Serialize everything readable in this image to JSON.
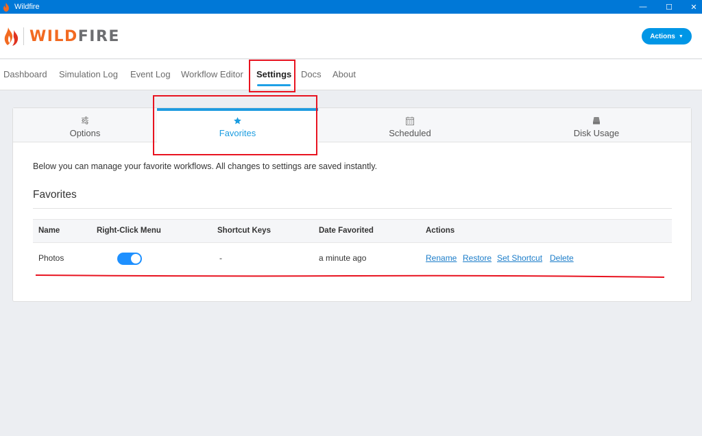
{
  "window": {
    "title": "Wildfire",
    "controls": {
      "minimize": "—",
      "maximize": "☐",
      "close": "✕"
    }
  },
  "header": {
    "logo_part1": "WILD",
    "logo_part2": "FIRE",
    "actions_label": "Actions",
    "actions_caret": "▼"
  },
  "nav": {
    "items": [
      {
        "label": "Dashboard"
      },
      {
        "label": "Simulation Log"
      },
      {
        "label": "Event Log"
      },
      {
        "label": "Workflow Editor"
      },
      {
        "label": "Settings",
        "active": true
      },
      {
        "label": "Docs"
      },
      {
        "label": "About"
      }
    ]
  },
  "tabs": [
    {
      "label": "Options",
      "icon": "sliders-icon"
    },
    {
      "label": "Favorites",
      "icon": "star-icon",
      "active": true
    },
    {
      "label": "Scheduled",
      "icon": "calendar-icon"
    },
    {
      "label": "Disk Usage",
      "icon": "drive-icon"
    }
  ],
  "content": {
    "description": "Below you can manage your favorite workflows. All changes to settings are saved instantly.",
    "section_title": "Favorites"
  },
  "table": {
    "headers": [
      "Name",
      "Right-Click Menu",
      "Shortcut Keys",
      "Date Favorited",
      "Actions"
    ],
    "rows": [
      {
        "name": "Photos",
        "right_click_menu": "on",
        "shortcut_keys": "-",
        "date_favorited": "a minute ago",
        "actions": [
          "Rename",
          "Restore",
          "Set Shortcut",
          "Delete"
        ]
      }
    ]
  },
  "colors": {
    "titlebar": "#0078d7",
    "accent": "#1e9be0",
    "brand_orange": "#f26a21",
    "brand_gray": "#6d6e71",
    "annotation_red": "#e8121f"
  }
}
